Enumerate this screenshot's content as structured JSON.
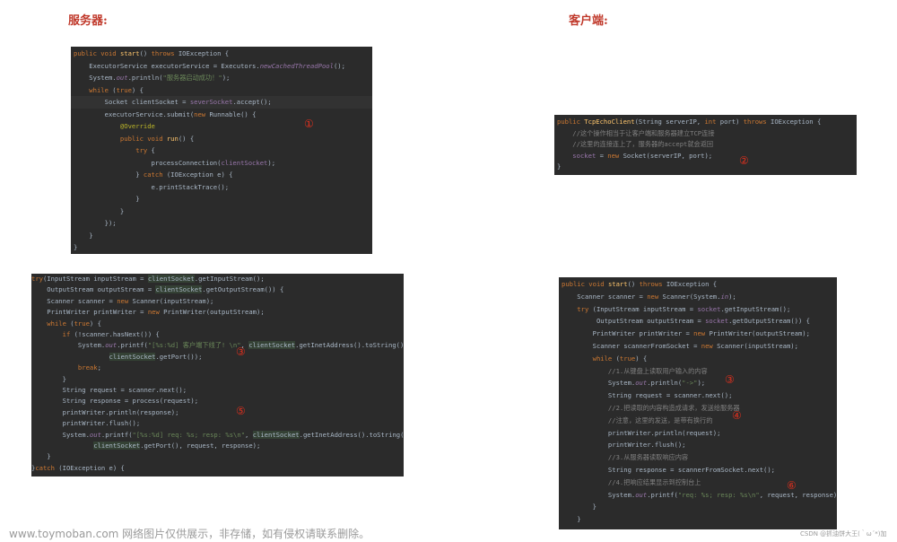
{
  "headings": {
    "server": "服务器:",
    "client": "客户端:"
  },
  "panels": {
    "server_top": {
      "marker": "①",
      "lines": [
        [
          [
            "kw",
            "public void "
          ],
          [
            "fn",
            "start"
          ],
          [
            "",
            "() "
          ],
          [
            "kw",
            "throws "
          ],
          [
            "",
            "IOException {"
          ]
        ],
        [
          [
            "",
            "    ExecutorService executorService = Executors."
          ],
          [
            "it",
            "newCachedThreadPool"
          ],
          [
            "",
            "();"
          ]
        ],
        [
          [
            "",
            "    System."
          ],
          [
            "it",
            "out"
          ],
          [
            "",
            ".println("
          ],
          [
            "st",
            "\"服务器启动成功！\""
          ],
          [
            "",
            ");"
          ]
        ],
        [
          [
            "kw",
            "    while "
          ],
          [
            "",
            "("
          ],
          [
            "kw",
            "true"
          ],
          [
            "",
            ") {"
          ]
        ],
        [
          [
            "",
            "        Socket clientSocket = "
          ],
          [
            "fd",
            "severSocket"
          ],
          [
            "",
            ".accept();"
          ]
        ],
        [
          [
            "",
            "        executorService.submit("
          ],
          [
            "kw",
            "new "
          ],
          [
            "",
            "Runnable() {"
          ]
        ],
        [
          [
            "an",
            "            @Override"
          ]
        ],
        [
          [
            "kw",
            "            public void "
          ],
          [
            "fn",
            "run"
          ],
          [
            "",
            "() {"
          ]
        ],
        [
          [
            "kw",
            "                try "
          ],
          [
            "",
            "{"
          ]
        ],
        [
          [
            "",
            "                    processConnection("
          ],
          [
            "fd",
            "clientSocket"
          ],
          [
            "",
            ");"
          ]
        ],
        [
          [
            "",
            "                } "
          ],
          [
            "kw",
            "catch "
          ],
          [
            "",
            "(IOException e) {"
          ]
        ],
        [
          [
            "",
            "                    e.printStackTrace();"
          ]
        ],
        [
          [
            "",
            "                }"
          ]
        ],
        [
          [
            "",
            "            }"
          ]
        ],
        [
          [
            "",
            "        });"
          ]
        ],
        [
          [
            "",
            "    }"
          ]
        ],
        [
          [
            "",
            "}"
          ]
        ]
      ]
    },
    "server_bottom": {
      "marker_a": "③",
      "marker_b": "⑤",
      "lines": [
        [
          [
            "kw",
            "try"
          ],
          [
            "",
            "(InputStream inputStream = "
          ],
          [
            "vu",
            "clientSocket"
          ],
          [
            "",
            ".getInputStream();"
          ]
        ],
        [
          [
            "",
            "    OutputStream outputStream = "
          ],
          [
            "vu",
            "clientSocket"
          ],
          [
            "",
            ".getOutputStream()) {"
          ]
        ],
        [
          [
            "",
            "    Scanner scanner = "
          ],
          [
            "kw",
            "new "
          ],
          [
            "",
            "Scanner(inputStream);"
          ]
        ],
        [
          [
            "",
            "    PrintWriter printWriter = "
          ],
          [
            "kw",
            "new "
          ],
          [
            "",
            "PrintWriter(outputStream);"
          ]
        ],
        [
          [
            "kw",
            "    while "
          ],
          [
            "",
            "("
          ],
          [
            "kw",
            "true"
          ],
          [
            "",
            ") {"
          ]
        ],
        [
          [
            "kw",
            "        if "
          ],
          [
            "",
            "(!scanner.hasNext()) {"
          ]
        ],
        [
          [
            "",
            "            System."
          ],
          [
            "it",
            "out"
          ],
          [
            "",
            ".printf("
          ],
          [
            "st",
            "\"[%s:%d] 客户端下线了! \\n\""
          ],
          [
            "",
            ", "
          ],
          [
            "vu",
            "clientSocket"
          ],
          [
            "",
            ".getInetAddress().toString(),"
          ]
        ],
        [
          [
            "",
            "                    "
          ],
          [
            "vu",
            "clientSocket"
          ],
          [
            "",
            ".getPort());"
          ]
        ],
        [
          [
            "kw",
            "            break"
          ],
          [
            "",
            ";"
          ]
        ],
        [
          [
            "",
            "        }"
          ]
        ],
        [
          [
            "",
            "        String request = scanner.next();"
          ]
        ],
        [
          [
            "",
            "        String response = process(request);"
          ]
        ],
        [
          [
            "",
            "        printWriter.println(response);"
          ]
        ],
        [
          [
            "",
            "        printWriter.flush();"
          ]
        ],
        [
          [
            "",
            "        System."
          ],
          [
            "it",
            "out"
          ],
          [
            "",
            ".printf("
          ],
          [
            "st",
            "\"[%s:%d] req: %s; resp: %s\\n\""
          ],
          [
            "",
            ", "
          ],
          [
            "vu",
            "clientSocket"
          ],
          [
            "",
            ".getInetAddress().toString(),"
          ]
        ],
        [
          [
            "",
            "                "
          ],
          [
            "vu",
            "clientSocket"
          ],
          [
            "",
            ".getPort(), request, response);"
          ]
        ],
        [
          [
            "",
            "    }"
          ]
        ],
        [
          [
            "",
            "}"
          ],
          [
            "kw",
            "catch "
          ],
          [
            "",
            "(IOException e) {"
          ]
        ]
      ]
    },
    "client_top": {
      "marker": "②",
      "lines": [
        [
          [
            "kw",
            "public "
          ],
          [
            "fn",
            "TcpEchoClient"
          ],
          [
            "",
            "(String serverIP, "
          ],
          [
            "kw",
            "int "
          ],
          [
            "",
            "port) "
          ],
          [
            "kw",
            "throws "
          ],
          [
            "",
            "IOException {"
          ]
        ],
        [
          [
            "cm",
            "    //这个操作相当于让客户端和服务器建立TCP连接"
          ]
        ],
        [
          [
            "cm",
            "    //这里的连接连上了，服务器的accept就会返回"
          ]
        ],
        [
          [
            "fd",
            "    socket "
          ],
          [
            "",
            "= "
          ],
          [
            "kw",
            "new "
          ],
          [
            "",
            "Socket(serverIP, port);"
          ]
        ],
        [
          [
            "",
            "}"
          ]
        ]
      ]
    },
    "client_bottom": {
      "marker_a": "③",
      "marker_b": "④",
      "marker_c": "⑥",
      "lines": [
        [
          [
            "kw",
            "public void "
          ],
          [
            "fn",
            "start"
          ],
          [
            "",
            "() "
          ],
          [
            "kw",
            "throws "
          ],
          [
            "",
            "IOException {"
          ]
        ],
        [
          [
            "",
            "    Scanner scanner = "
          ],
          [
            "kw",
            "new "
          ],
          [
            "",
            "Scanner(System."
          ],
          [
            "it",
            "in"
          ],
          [
            "",
            ");"
          ]
        ],
        [
          [
            "kw",
            "    try "
          ],
          [
            "",
            "(InputStream inputStream = "
          ],
          [
            "fd",
            "socket"
          ],
          [
            "",
            ".getInputStream();"
          ]
        ],
        [
          [
            "",
            "         OutputStream outputStream = "
          ],
          [
            "fd",
            "socket"
          ],
          [
            "",
            ".getOutputStream()) {"
          ]
        ],
        [
          [
            "",
            "        PrintWriter printWriter = "
          ],
          [
            "kw",
            "new "
          ],
          [
            "",
            "PrintWriter(outputStream);"
          ]
        ],
        [
          [
            "",
            "        Scanner scannerFromSocket = "
          ],
          [
            "kw",
            "new "
          ],
          [
            "",
            "Scanner(inputStream);"
          ]
        ],
        [
          [
            "kw",
            "        while "
          ],
          [
            "",
            "("
          ],
          [
            "kw",
            "true"
          ],
          [
            "",
            ") {"
          ]
        ],
        [
          [
            "cm",
            "            //1.从键盘上读取用户输入的内容"
          ]
        ],
        [
          [
            "",
            "            System."
          ],
          [
            "it",
            "out"
          ],
          [
            "",
            ".println("
          ],
          [
            "st",
            "\"->\""
          ],
          [
            "",
            ");"
          ]
        ],
        [
          [
            "",
            "            String request = scanner.next();"
          ]
        ],
        [
          [
            "cm",
            "            //2.把读取的内容构造成请求，发送给服务器"
          ]
        ],
        [
          [
            "cm",
            "            //注意，这里的发送，是带有换行的"
          ]
        ],
        [
          [
            "",
            "            printWriter.println(request);"
          ]
        ],
        [
          [
            "",
            "            printWriter.flush();"
          ]
        ],
        [
          [
            "cm",
            "            //3.从服务器读取响应内容"
          ]
        ],
        [
          [
            "",
            "            String response = scannerFromSocket.next();"
          ]
        ],
        [
          [
            "cm",
            "            //4.把响应结果显示到控制台上"
          ]
        ],
        [
          [
            "",
            "            System."
          ],
          [
            "it",
            "out"
          ],
          [
            "",
            ".printf("
          ],
          [
            "st",
            "\"req: %s; resp: %s\\n\""
          ],
          [
            "",
            ", request, response);"
          ]
        ],
        [
          [
            "",
            "        }"
          ]
        ],
        [
          [
            "",
            "    }"
          ]
        ]
      ]
    }
  },
  "footer": {
    "watermark": "www.toymoban.com 网络图片仅供展示，非存储，如有侵权请联系删除。",
    "credit": "CSDN @抓油饼大王(｀ω´*)加"
  }
}
